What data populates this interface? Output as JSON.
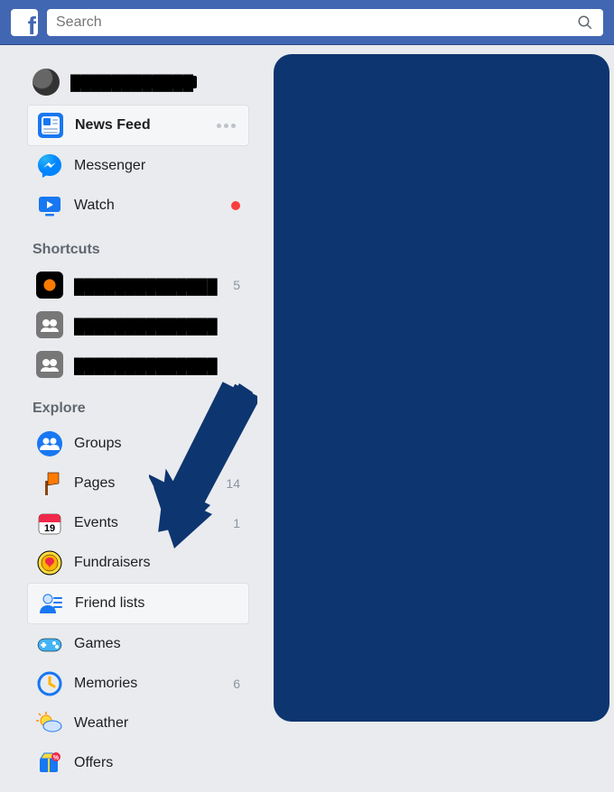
{
  "search": {
    "placeholder": "Search"
  },
  "user": {
    "name": "████████████"
  },
  "main_nav": {
    "news_feed": "News Feed",
    "messenger": "Messenger",
    "watch": "Watch"
  },
  "sections": {
    "shortcuts": "Shortcuts",
    "explore": "Explore"
  },
  "shortcuts": [
    {
      "label": "██████████████",
      "count": "5"
    },
    {
      "label": "██████████████",
      "count": ""
    },
    {
      "label": "██████████████",
      "count": ""
    }
  ],
  "explore": {
    "groups": {
      "label": "Groups",
      "count": ""
    },
    "pages": {
      "label": "Pages",
      "count": "14"
    },
    "events": {
      "label": "Events",
      "count": "1"
    },
    "fundraisers": {
      "label": "Fundraisers",
      "count": ""
    },
    "friendlists": {
      "label": "Friend lists",
      "count": ""
    },
    "games": {
      "label": "Games",
      "count": ""
    },
    "memories": {
      "label": "Memories",
      "count": "6"
    },
    "weather": {
      "label": "Weather",
      "count": ""
    },
    "offers": {
      "label": "Offers",
      "count": ""
    }
  },
  "colors": {
    "brand": "#4267b2",
    "panel": "#0d3570",
    "arrow": "#0d3570"
  }
}
